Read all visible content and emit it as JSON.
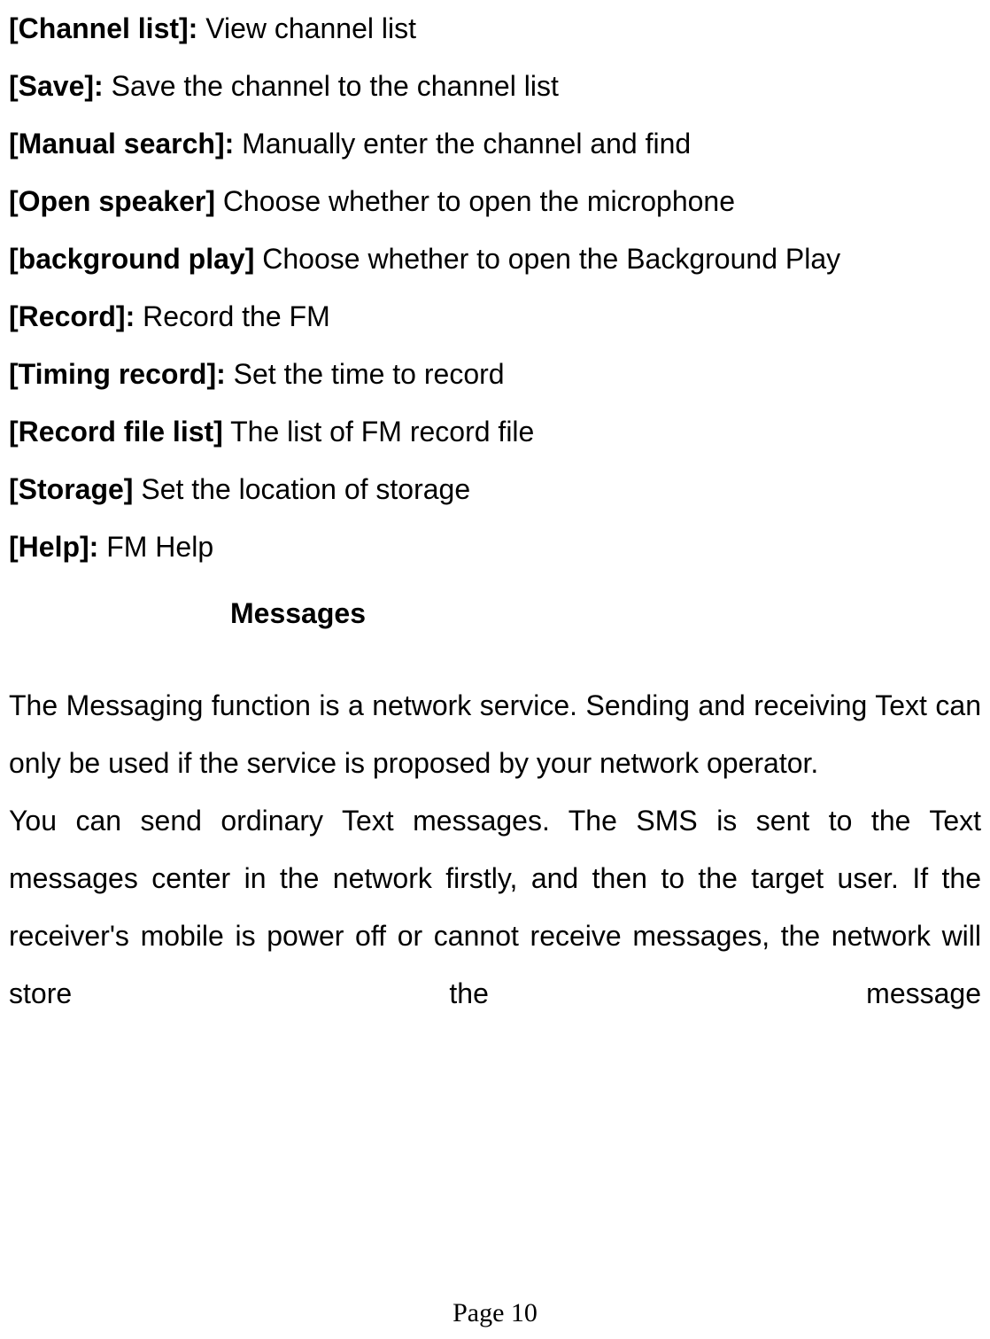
{
  "definitions": [
    {
      "term": "[Channel list]:",
      "desc": " View channel list",
      "justify": false
    },
    {
      "term": "[Save]:",
      "desc": " Save the channel to the channel list",
      "justify": false
    },
    {
      "term": "[Manual search]:",
      "desc": " Manually enter the channel and find",
      "justify": false
    },
    {
      "term": "[Open speaker]",
      "desc": " Choose whether to open the microphone",
      "justify": false
    },
    {
      "term": "[background play]",
      "desc": " Choose whether to open the Background Play",
      "justify": true
    },
    {
      "term": "[Record]:",
      "desc": " Record the FM",
      "justify": false
    },
    {
      "term": "[Timing record]:",
      "desc": " Set the time to record",
      "justify": false
    },
    {
      "term": "[Record file list]",
      "desc": "   The list of FM record file",
      "justify": false
    },
    {
      "term": "[Storage]",
      "desc": " Set the location of storage",
      "justify": false
    },
    {
      "term": "[Help]:",
      "desc": " FM Help",
      "justify": false
    }
  ],
  "heading": "Messages",
  "paragraphs": [
    {
      "text": "The Messaging function is a network service. Sending and receiving Text can only be used if the service is proposed by your network operator.",
      "lastLineJustify": false
    },
    {
      "text": "You can send ordinary Text messages. The SMS is sent to the Text messages center in the network firstly, and then to the target user. If the receiver's mobile is power off or cannot receive messages, the network will store the message",
      "lastLineJustify": true
    }
  ],
  "footer": "Page 10"
}
